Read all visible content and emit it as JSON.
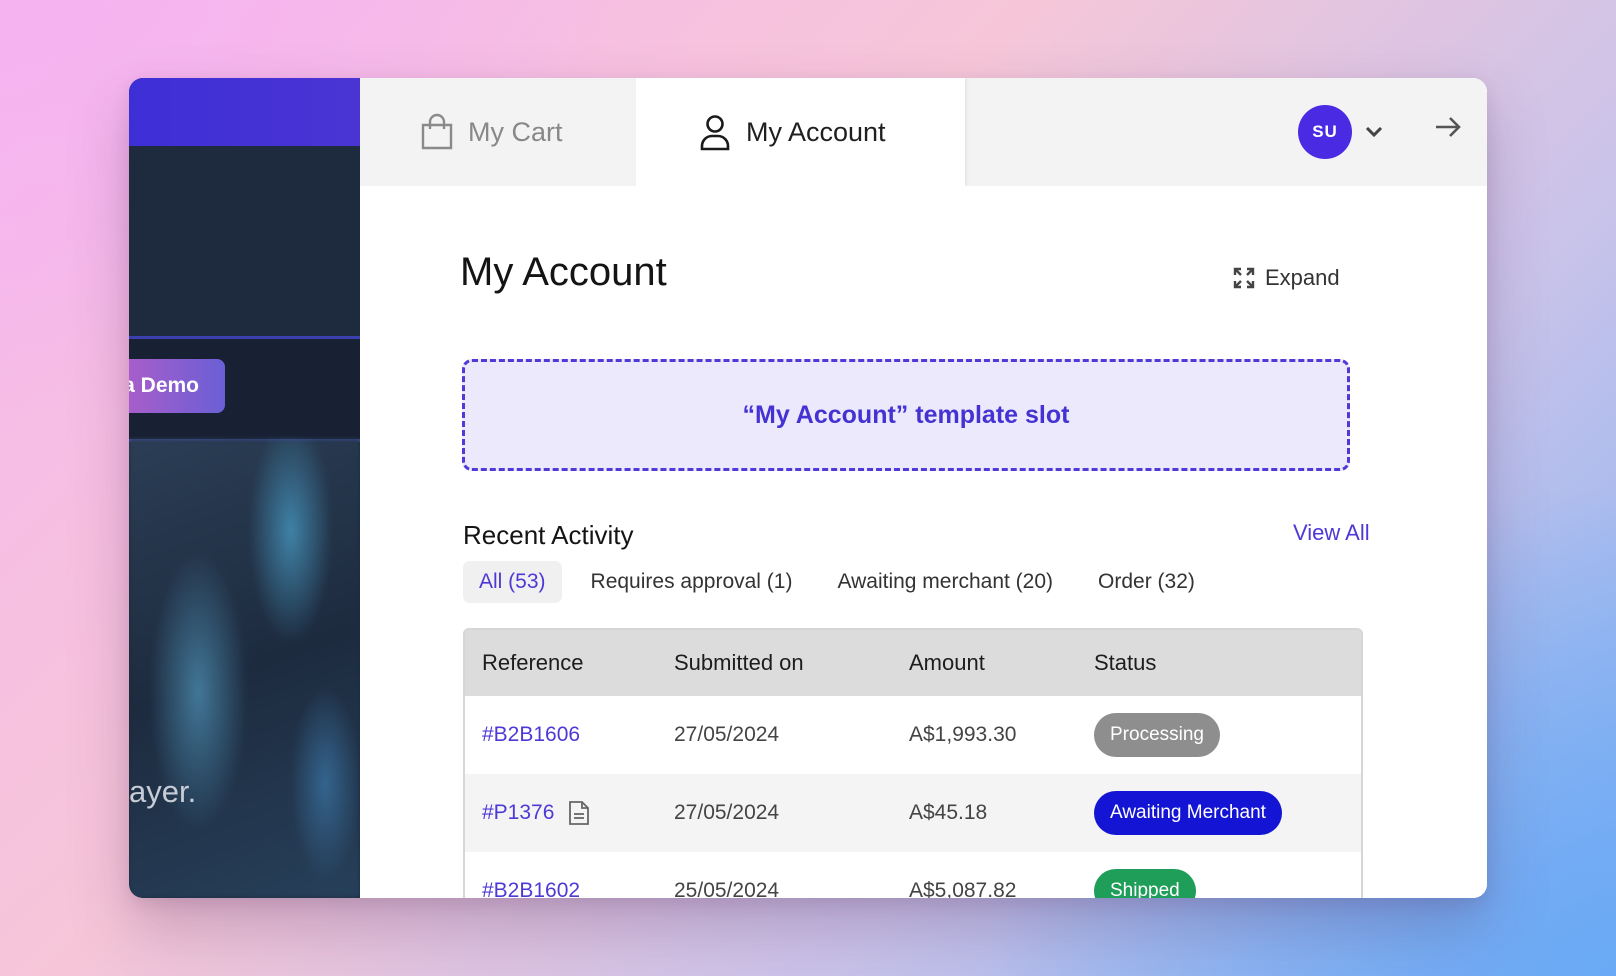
{
  "site": {
    "demo_button_label": "a Demo",
    "hero_text": "ayer."
  },
  "tabs": {
    "cart": {
      "label": "My Cart",
      "icon": "shopping-bag-icon"
    },
    "account": {
      "label": "My Account",
      "icon": "user-icon"
    }
  },
  "user": {
    "initials": "SU"
  },
  "header": {
    "title": "My Account",
    "expand_label": "Expand"
  },
  "slot": {
    "label": "“My Account” template slot"
  },
  "activity": {
    "title": "Recent Activity",
    "view_all": "View All",
    "filters": [
      {
        "label": "All  (53)",
        "active": true
      },
      {
        "label": "Requires approval  (1)",
        "active": false
      },
      {
        "label": "Awaiting merchant  (20)",
        "active": false
      },
      {
        "label": "Order  (32)",
        "active": false
      }
    ],
    "columns": [
      "Reference",
      "Submitted on",
      "Amount",
      "Status"
    ],
    "rows": [
      {
        "reference": "#B2B1606",
        "date": "27/05/2024",
        "amount": "A$1,993.30",
        "status": "Processing",
        "status_color": "#8e8e8e",
        "has_doc": false
      },
      {
        "reference": "#P1376",
        "date": "27/05/2024",
        "amount": "A$45.18",
        "status": "Awaiting Merchant",
        "status_color": "#1414d4",
        "has_doc": true
      },
      {
        "reference": "#B2B1602",
        "date": "25/05/2024",
        "amount": "A$5,087.82",
        "status": "Shipped",
        "status_color": "#1f9e5a",
        "has_doc": false
      }
    ]
  },
  "colors": {
    "accent": "#4d39d6",
    "avatar": "#4a2be3"
  }
}
